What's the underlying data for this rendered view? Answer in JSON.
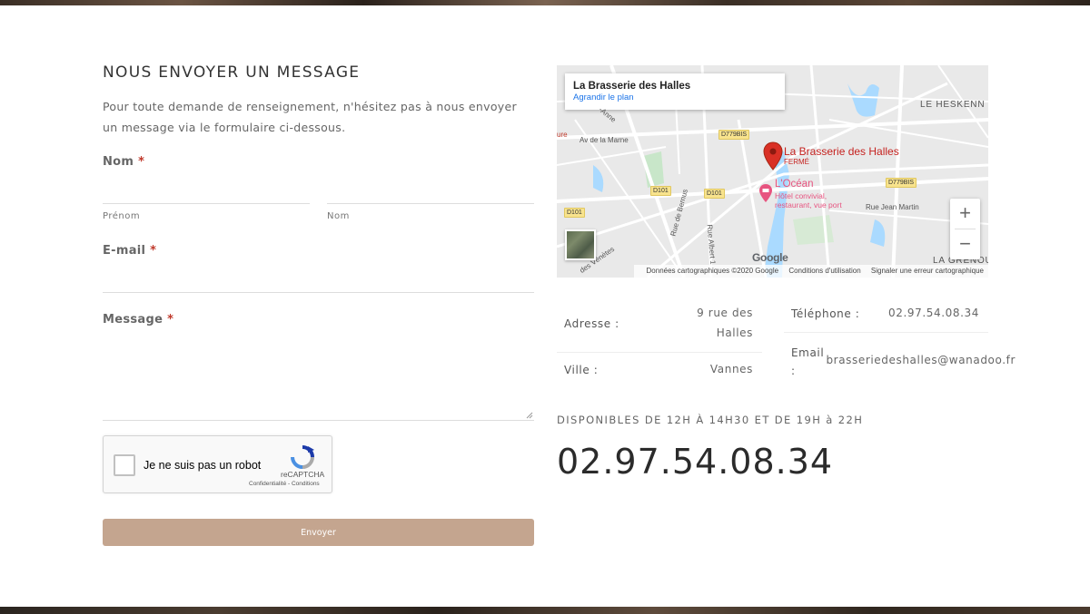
{
  "form": {
    "title": "NOUS ENVOYER UN MESSAGE",
    "intro": "Pour toute demande de renseignement, n'hésitez pas à nous envoyer un message via le formulaire ci-dessous.",
    "name_label": "Nom",
    "required_mark": "*",
    "firstname_sublabel": "Prénom",
    "lastname_sublabel": "Nom",
    "email_label": "E-mail",
    "message_label": "Message",
    "submit_label": "Envoyer"
  },
  "captcha": {
    "checkbox_label": "Je ne suis pas un robot",
    "brand": "reCAPTCHA",
    "links": "Confidentialité - Conditions"
  },
  "map": {
    "place_name": "La Brasserie des Halles",
    "enlarge_link": "Agrandir le plan",
    "marker_name": "La Brasserie des Halles",
    "marker_status": "FERMÉ",
    "poi_name": "L'Océan",
    "poi_desc_1": "Hôtel convivial,",
    "poi_desc_2": "restaurant, vue port",
    "labels": {
      "heskenn": "LE HESKENN",
      "grenouil": "LA GRENOUI",
      "marne": "Av de la Marne",
      "anne": "-Anne",
      "ure": "ure",
      "jean_martin": "Rue Jean Martin",
      "bernus": "Rue de Bernus",
      "albert": "Rue Albert 1",
      "venetes": "des Vénètes"
    },
    "road_badges": [
      "D779BIS",
      "D101",
      "D101",
      "D101",
      "D779BIS"
    ],
    "zoom_in": "+",
    "zoom_out": "−",
    "google_logo": "Google",
    "attribution": "Données cartographiques ©2020 Google",
    "terms": "Conditions d'utilisation",
    "report": "Signaler une erreur cartographique"
  },
  "contact": {
    "address_label": "Adresse :",
    "address_value_1": "9 rue des",
    "address_value_2": "Halles",
    "city_label": "Ville :",
    "city_value": "Vannes",
    "phone_label": "Téléphone :",
    "phone_value": "02.97.54.08.34",
    "email_label_1": "Email",
    "email_label_2": ":",
    "email_value": "brasseriedeshalles@wanadoo.fr",
    "hours": "DISPONIBLES DE 12H À 14H30 ET DE 19H à 22H",
    "big_phone": "02.97.54.08.34"
  },
  "colors": {
    "accent_button": "#c4a58f",
    "required": "#c0392b",
    "map_marker": "#d93025",
    "map_poi": "#e75480"
  }
}
